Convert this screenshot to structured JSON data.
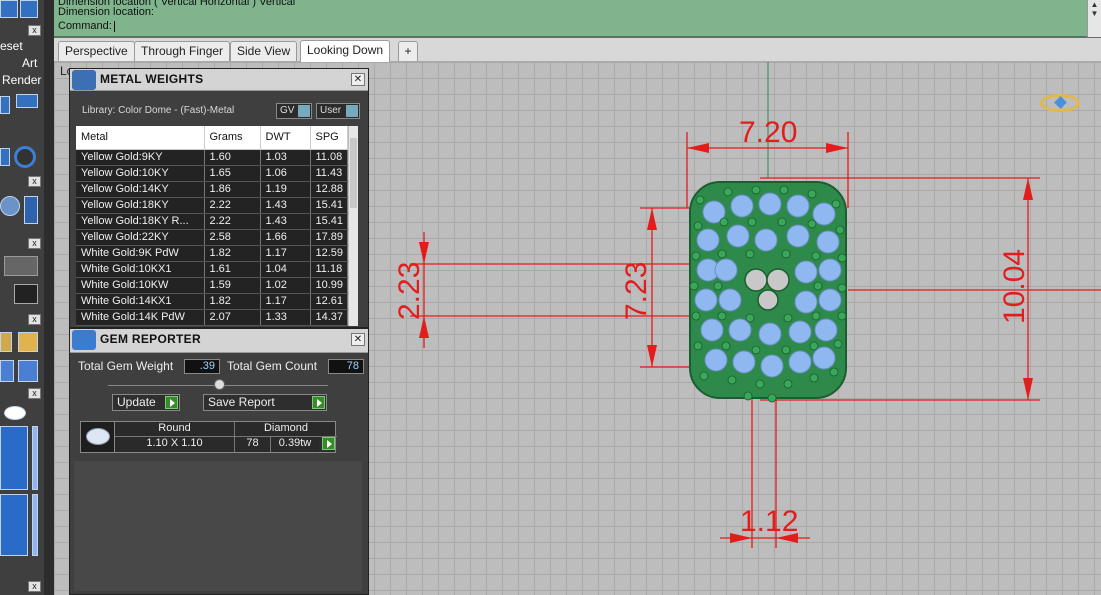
{
  "command": {
    "line1": "Dimension location ( Vertical  Horizontal )  Vertical",
    "line2": "Dimension location:",
    "line3": "Command:"
  },
  "left_toolbar": {
    "reset_label": "eset",
    "art_label": "Art",
    "render_label": "Render",
    "close_glyph": "x"
  },
  "tabs": [
    {
      "label": "Perspective"
    },
    {
      "label": "Through Finger"
    },
    {
      "label": "Side View"
    },
    {
      "label": "Looking Down"
    },
    {
      "label": "+"
    }
  ],
  "viewport": {
    "label": "Lo..."
  },
  "metal_weights": {
    "title": "METAL WEIGHTS",
    "library": "Library: Color Dome - (Fast)-Metal",
    "gv_label": "GV",
    "user_label": "User",
    "columns": [
      "Metal",
      "Grams",
      "DWT",
      "SPG"
    ],
    "rows": [
      [
        "Yellow Gold:9KY",
        "1.60",
        "1.03",
        "11.08"
      ],
      [
        "Yellow Gold:10KY",
        "1.65",
        "1.06",
        "11.43"
      ],
      [
        "Yellow Gold:14KY",
        "1.86",
        "1.19",
        "12.88"
      ],
      [
        "Yellow Gold:18KY",
        "2.22",
        "1.43",
        "15.41"
      ],
      [
        "Yellow Gold:18KY R...",
        "2.22",
        "1.43",
        "15.41"
      ],
      [
        "Yellow Gold:22KY",
        "2.58",
        "1.66",
        "17.89"
      ],
      [
        "White Gold:9K PdW",
        "1.82",
        "1.17",
        "12.59"
      ],
      [
        "White Gold:10KX1",
        "1.61",
        "1.04",
        "11.18"
      ],
      [
        "White Gold:10KW",
        "1.59",
        "1.02",
        "10.99"
      ],
      [
        "White Gold:14KX1",
        "1.82",
        "1.17",
        "12.61"
      ],
      [
        "White Gold:14K PdW",
        "2.07",
        "1.33",
        "14.37"
      ]
    ]
  },
  "gem_reporter": {
    "title": "GEM REPORTER",
    "total_weight_label": "Total Gem Weight",
    "total_weight_value": ".39",
    "total_count_label": "Total Gem Count",
    "total_count_value": "78",
    "update_label": "Update",
    "save_report_label": "Save Report",
    "gem": {
      "shape": "Round",
      "size": "1.10 X 1.10",
      "stone": "Diamond",
      "count": "78",
      "weight": "0.39tw"
    }
  },
  "dimensions": {
    "top_width": "7.20",
    "left_small": "2.23",
    "left_height": "7.23",
    "right_height": "10.04",
    "bottom_width": "1.12"
  },
  "colors": {
    "dimension": "#e31c1c",
    "metal": "#2d8a4a",
    "gem": "#8fb8f0",
    "command_bg": "#7fb48c"
  }
}
